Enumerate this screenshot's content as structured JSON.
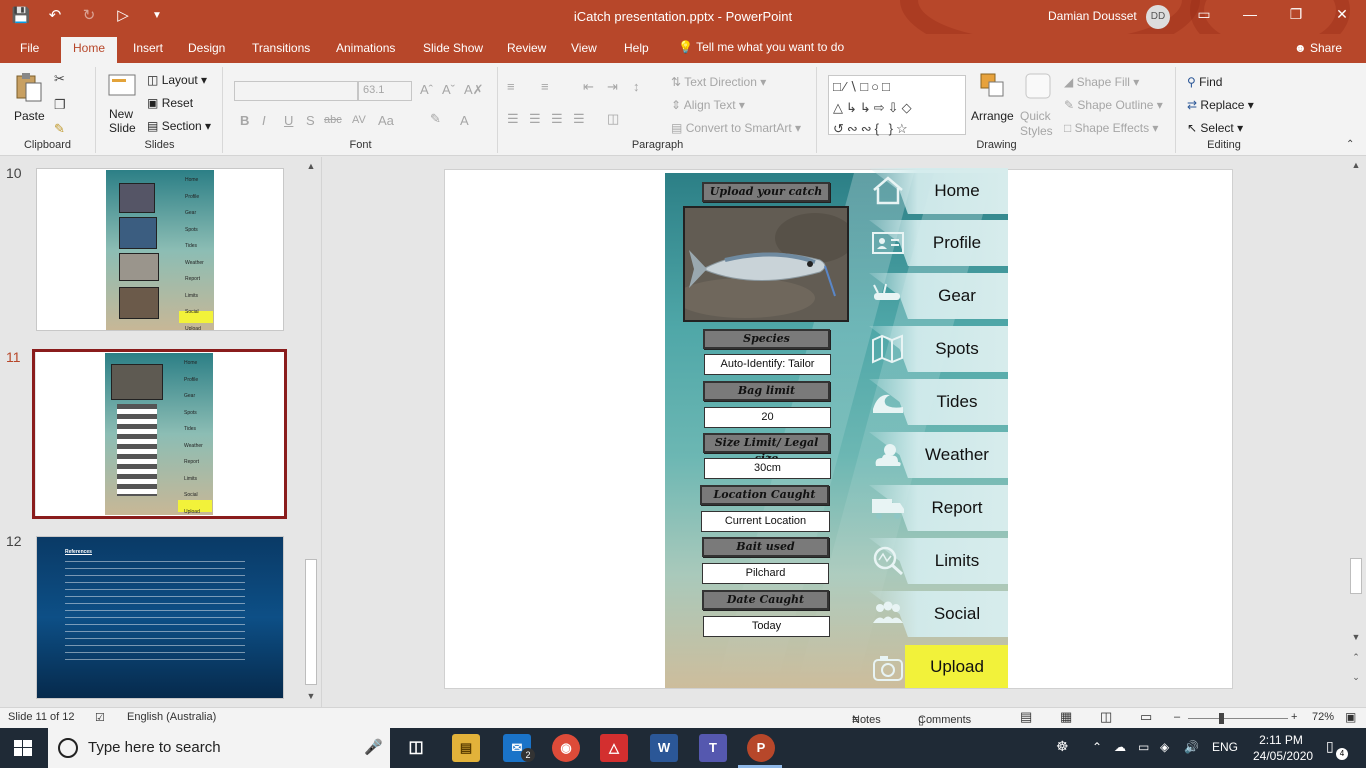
{
  "titlebar": {
    "title": "iCatch presentation.pptx  -  PowerPoint",
    "user": "Damian Dousset",
    "initials": "DD",
    "qat": [
      "save-icon",
      "undo-icon",
      "redo-icon",
      "start-from-beginning-icon",
      "customize-qat-icon"
    ],
    "window_controls": [
      "ribbon-display-options-icon",
      "minimize-icon",
      "restore-icon",
      "close-icon"
    ]
  },
  "tabs": [
    "File",
    "Home",
    "Insert",
    "Design",
    "Transitions",
    "Animations",
    "Slide Show",
    "Review",
    "View",
    "Help"
  ],
  "active_tab": "Home",
  "tell_me": "Tell me what you want to do",
  "share": "Share",
  "ribbon": {
    "clipboard": {
      "label": "Clipboard",
      "paste": "Paste"
    },
    "slides": {
      "label": "Slides",
      "new_slide": "New\nSlide",
      "layout": "Layout",
      "reset": "Reset",
      "section": "Section"
    },
    "font": {
      "label": "Font",
      "font_name": "",
      "font_size": "63.1",
      "buttons": [
        "B",
        "I",
        "U",
        "S",
        "abc",
        "AV",
        "Aa",
        "A"
      ]
    },
    "paragraph": {
      "label": "Paragraph",
      "text_direction": "Text Direction",
      "align_text": "Align Text",
      "convert_smartart": "Convert to SmartArt"
    },
    "drawing": {
      "label": "Drawing",
      "arrange": "Arrange",
      "quick_styles": "Quick\nStyles",
      "shape_fill": "Shape Fill",
      "shape_outline": "Shape Outline",
      "shape_effects": "Shape Effects"
    },
    "editing": {
      "label": "Editing",
      "find": "Find",
      "replace": "Replace",
      "select": "Select"
    }
  },
  "thumbnails": {
    "slides": [
      {
        "number": "10",
        "nav": [
          "Home",
          "Profile",
          "Gear",
          "Spots",
          "Tides",
          "Weather",
          "Report",
          "Limits",
          "Social",
          "Upload"
        ]
      },
      {
        "number": "11",
        "nav": [
          "Home",
          "Profile",
          "Gear",
          "Spots",
          "Tides",
          "Weather",
          "Report",
          "Limits",
          "Social",
          "Upload"
        ]
      },
      {
        "number": "12",
        "heading": "References"
      }
    ],
    "selected": "11"
  },
  "slide": {
    "upload_header": "Upload your catch",
    "fields": [
      {
        "header": "Species",
        "value": "Auto-Identify: Tailor"
      },
      {
        "header": "Bag limit",
        "value": "20"
      },
      {
        "header": "Size Limit/ Legal size",
        "value": "30cm"
      },
      {
        "header": "Location Caught",
        "value": "Current Location"
      },
      {
        "header": "Bait used",
        "value": "Pilchard"
      },
      {
        "header": "Date Caught",
        "value": "Today"
      }
    ],
    "nav": [
      {
        "label": "Home",
        "icon": "home-icon"
      },
      {
        "label": "Profile",
        "icon": "id-card-icon"
      },
      {
        "label": "Gear",
        "icon": "multitool-icon"
      },
      {
        "label": "Spots",
        "icon": "map-icon"
      },
      {
        "label": "Tides",
        "icon": "wave-icon"
      },
      {
        "label": "Weather",
        "icon": "sun-cloud-icon"
      },
      {
        "label": "Report",
        "icon": "truck-icon"
      },
      {
        "label": "Limits",
        "icon": "gauge-magnifier-icon"
      },
      {
        "label": "Social",
        "icon": "people-icon"
      },
      {
        "label": "Upload",
        "icon": "camera-icon"
      }
    ],
    "highlight_color": "#f2f23a"
  },
  "status": {
    "slide_of": "Slide 11 of 12",
    "language": "English (Australia)",
    "notes": "Notes",
    "comments": "Comments",
    "zoom": "72%"
  },
  "taskbar": {
    "search_placeholder": "Type here to search",
    "mail_badge": "2",
    "language": "ENG",
    "time": "2:11 PM",
    "date": "24/05/2020",
    "notifications": "4"
  },
  "colors": {
    "brand": "#b7472a",
    "selection": "#8a1c1c"
  }
}
